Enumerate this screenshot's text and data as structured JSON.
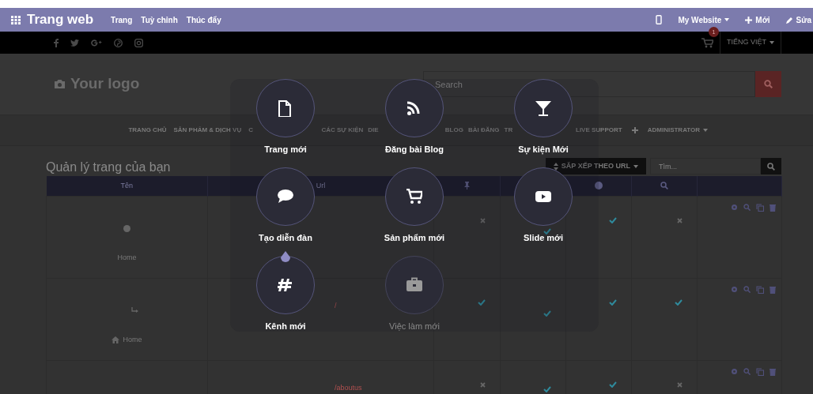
{
  "topbar": {
    "app_title": "Trang web",
    "menu": [
      "Trang",
      "Tuỳ chỉnh",
      "Thúc đẩy"
    ],
    "actions": [
      {
        "kind": "device"
      },
      {
        "kind": "dropdown",
        "label": "My Website"
      },
      {
        "kind": "new",
        "label": "Mới"
      },
      {
        "kind": "edit",
        "label": "Sửa"
      }
    ]
  },
  "utility_bar": {
    "cart_count": "1",
    "language": "TIẾNG VIỆT"
  },
  "header": {
    "logo": "Your logo",
    "search": {
      "placeholder": "Search"
    }
  },
  "nav_groups": [
    [
      "TRANG CHỦ",
      "SẢN PHẨM & DỊCH VỤ",
      "C"
    ],
    [
      "CÁC SỰ KIỆN",
      "DIE"
    ],
    [
      "BLOG",
      "BÀI ĐĂNG",
      "TR"
    ],
    [
      "LIVE SUPPORT",
      "ADMINISTRATOR"
    ]
  ],
  "page_title": "Quản lý trang của bạn",
  "sort_button": "SẮP XẾP THEO URL",
  "filter": {
    "placeholder": "Tìm..."
  },
  "table": {
    "columns": [
      "Tên",
      "Url"
    ],
    "rows": [
      {
        "kind": "page",
        "name": "Home",
        "flags": [
          false,
          true,
          true,
          false
        ]
      },
      {
        "kind": "child",
        "name": "Home",
        "url": "/",
        "flags": [
          true,
          true,
          true,
          true
        ]
      },
      {
        "kind": "partial",
        "url": "/aboutus",
        "flags": [
          false,
          true,
          true,
          false
        ]
      }
    ]
  },
  "new_content": [
    {
      "label": "Trang mới",
      "disabled": false
    },
    {
      "label": "Đăng bài Blog",
      "disabled": false
    },
    {
      "label": "Sự kiện Mới",
      "disabled": false
    },
    {
      "label": "Tạo diễn đàn",
      "disabled": false
    },
    {
      "label": "Sản phẩm mới",
      "disabled": false
    },
    {
      "label": "Slide mới",
      "disabled": false
    },
    {
      "label": "Kênh mới",
      "disabled": false
    },
    {
      "label": "Việc làm mới",
      "disabled": true
    }
  ]
}
